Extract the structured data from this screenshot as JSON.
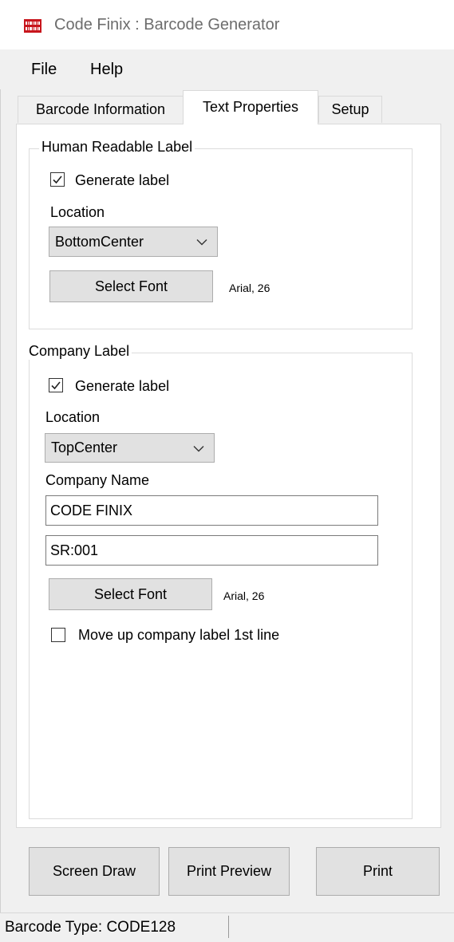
{
  "window": {
    "title": "Code Finix : Barcode Generator",
    "icon": "barcode-app-icon"
  },
  "menu": {
    "items": [
      "File",
      "Help"
    ]
  },
  "tabs": [
    {
      "label": "Barcode Information",
      "active": false
    },
    {
      "label": "Text Properties",
      "active": true
    },
    {
      "label": "Setup",
      "active": false
    }
  ],
  "human_readable": {
    "group_title": "Human Readable Label",
    "generate_label": "Generate label",
    "generate_checked": true,
    "location_label": "Location",
    "location_value": "BottomCenter",
    "select_font_label": "Select Font",
    "font_info": "Arial, 26"
  },
  "company": {
    "group_title": "Company Label",
    "generate_label": "Generate label",
    "generate_checked": true,
    "location_label": "Location",
    "location_value": "TopCenter",
    "company_name_label": "Company Name",
    "company_name_value": "CODE FINIX",
    "second_line_value": "SR:001",
    "select_font_label": "Select Font",
    "font_info": "Arial, 26",
    "move_up_label": "Move up company label 1st line",
    "move_up_checked": false
  },
  "actions": {
    "screen_draw": "Screen Draw",
    "print_preview": "Print Preview",
    "print": "Print"
  },
  "status": {
    "text": "Barcode Type: CODE128"
  }
}
